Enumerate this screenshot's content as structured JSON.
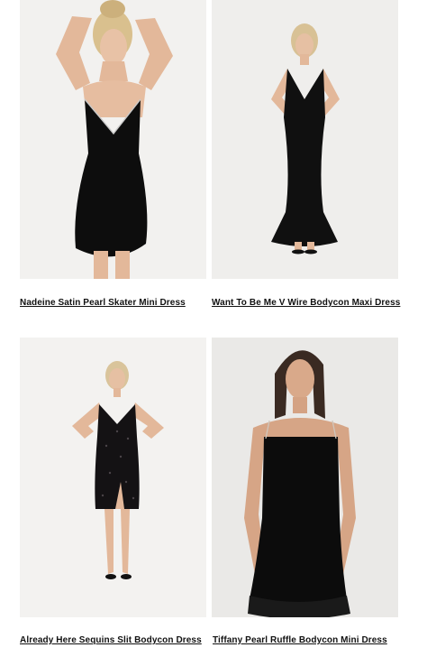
{
  "products": [
    {
      "name": "Nadeine Satin Pearl Skater Mini Dress",
      "image": "model-black-slip-mini-dress-photo"
    },
    {
      "name": "Want To Be Me V Wire Bodycon Maxi Dress",
      "image": "model-black-maxi-dress-photo"
    },
    {
      "name": "Already Here Sequins Slit Bodycon Dress",
      "image": "model-black-sequin-slit-dress-photo"
    },
    {
      "name": "Tiffany Pearl Ruffle Bodycon Mini Dress",
      "image": "model-black-ruffle-mini-dress-photo"
    }
  ]
}
